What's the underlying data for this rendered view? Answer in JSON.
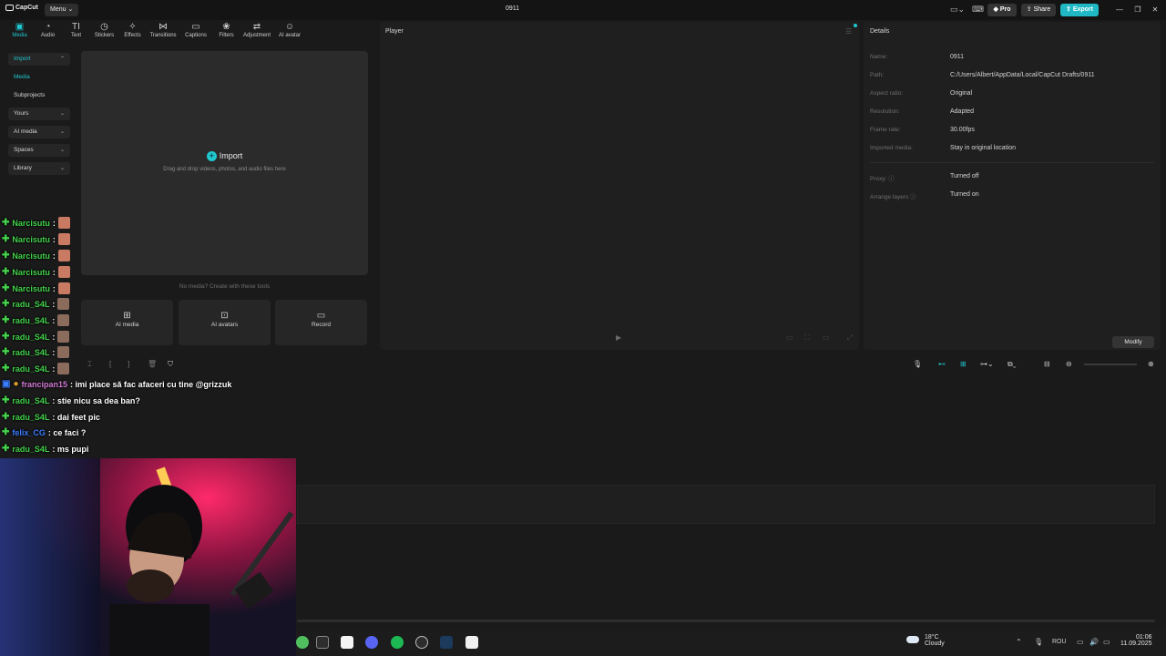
{
  "app": {
    "logo_text": "CapCut",
    "menu_label": "Menu",
    "project_title": "0911"
  },
  "header": {
    "pro_label": "Pro",
    "share_label": "Share",
    "export_label": "Export"
  },
  "toolbar": {
    "items": [
      {
        "label": "Media",
        "icon": "media-icon"
      },
      {
        "label": "Audio",
        "icon": "audio-icon"
      },
      {
        "label": "Text",
        "icon": "text-icon"
      },
      {
        "label": "Stickers",
        "icon": "stickers-icon"
      },
      {
        "label": "Effects",
        "icon": "effects-icon"
      },
      {
        "label": "Transitions",
        "icon": "transitions-icon"
      },
      {
        "label": "Captions",
        "icon": "captions-icon"
      },
      {
        "label": "Filters",
        "icon": "filters-icon"
      },
      {
        "label": "Adjustment",
        "icon": "adjustment-icon"
      },
      {
        "label": "AI avatar",
        "icon": "ai-avatar-icon"
      }
    ]
  },
  "sidebar": {
    "items": [
      {
        "label": "Import"
      },
      {
        "label": "Media"
      },
      {
        "label": "Subprojects"
      },
      {
        "label": "Yours"
      },
      {
        "label": "AI media"
      },
      {
        "label": "Spaces"
      },
      {
        "label": "Library"
      }
    ]
  },
  "media": {
    "import_label": "Import",
    "import_hint": "Drag and drop videos, photos, and audio files here",
    "no_media_text": "No media? Create with these tools",
    "tools": [
      {
        "label": "AI media",
        "icon": "ai-media-icon"
      },
      {
        "label": "AI avatars",
        "icon": "ai-avatars-icon"
      },
      {
        "label": "Record",
        "icon": "record-icon"
      }
    ]
  },
  "player": {
    "title": "Player"
  },
  "details": {
    "title": "Details",
    "rows": [
      {
        "label": "Name:",
        "value": "0911"
      },
      {
        "label": "Path:",
        "value": "C:/Users/Albert/AppData/Local/CapCut Drafts/0911"
      },
      {
        "label": "Aspect ratio:",
        "value": "Original"
      },
      {
        "label": "Resolution:",
        "value": "Adapted"
      },
      {
        "label": "Frame rate:",
        "value": "30.00fps"
      },
      {
        "label": "Imported media:",
        "value": "Stay in original location"
      },
      {
        "label": "Proxy: ⓘ",
        "value": "Turned off"
      },
      {
        "label": "Arrange layers ⓘ",
        "value": "Turned on"
      }
    ],
    "modify_label": "Modify"
  },
  "chat": {
    "messages": [
      {
        "user": "Narcisutu",
        "text": ":"
      },
      {
        "user": "Narcisutu",
        "text": ":"
      },
      {
        "user": "Narcisutu",
        "text": ":"
      },
      {
        "user": "Narcisutu",
        "text": ":"
      },
      {
        "user": "Narcisutu",
        "text": ":"
      },
      {
        "user": "radu_S4L",
        "text": ":"
      },
      {
        "user": "radu_S4L",
        "text": ":"
      },
      {
        "user": "radu_S4L",
        "text": ":"
      },
      {
        "user": "radu_S4L",
        "text": ":"
      },
      {
        "user": "radu_S4L",
        "text": ":"
      },
      {
        "user": "francipan15",
        "text": ": imi place să fac afaceri cu tine @grizzuk"
      },
      {
        "user": "radu_S4L",
        "text": ": stie nicu sa dea ban?"
      },
      {
        "user": "radu_S4L",
        "text": ": dai feet pic"
      },
      {
        "user": "felix_CG",
        "text": ": ce faci ?"
      },
      {
        "user": "radu_S4L",
        "text": ": ms pupi"
      }
    ]
  },
  "taskbar": {
    "weather_temp": "18°C",
    "weather_desc": "Cloudy",
    "language": "ROU",
    "time": "01:06",
    "date": "11.09.2025"
  },
  "colors": {
    "accent": "#1fc7cf",
    "export": "#1fb8c4",
    "chat_user": "#43d34b"
  }
}
